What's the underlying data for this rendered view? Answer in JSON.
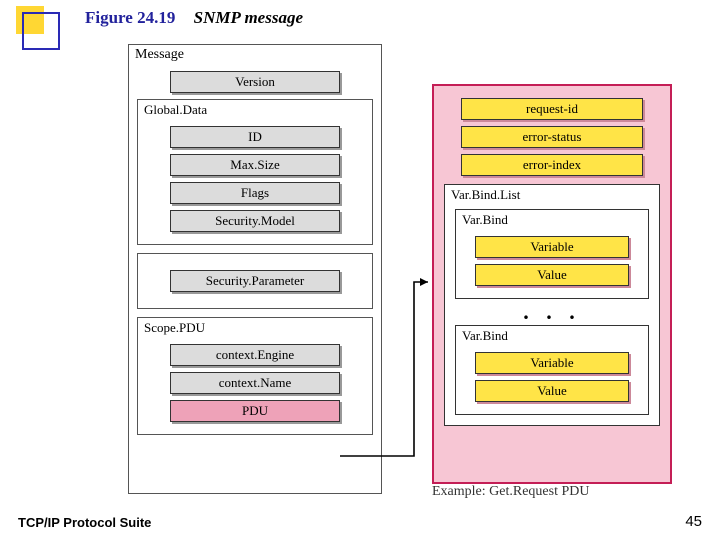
{
  "figure": {
    "number": "Figure 24.19",
    "title": "SNMP message"
  },
  "msg": {
    "title": "Message",
    "version": "Version",
    "global": {
      "title": "Global.Data",
      "id": "ID",
      "maxsize": "Max.Size",
      "flags": "Flags",
      "secmodel": "Security.Model"
    },
    "secparam": "Security.Parameter",
    "scope": {
      "title": "Scope.PDU",
      "ctxengine": "context.Engine",
      "ctxname": "context.Name",
      "pdu": "PDU"
    }
  },
  "pdu": {
    "request_id": "request-id",
    "error_status": "error-status",
    "error_index": "error-index",
    "varbindlist": {
      "title": "Var.Bind.List",
      "varbind_label": "Var.Bind",
      "variable": "Variable",
      "value": "Value",
      "dots": ". . ."
    },
    "example": "Example: Get.Request PDU"
  },
  "footer": {
    "suite": "TCP/IP Protocol Suite",
    "page": "45"
  }
}
